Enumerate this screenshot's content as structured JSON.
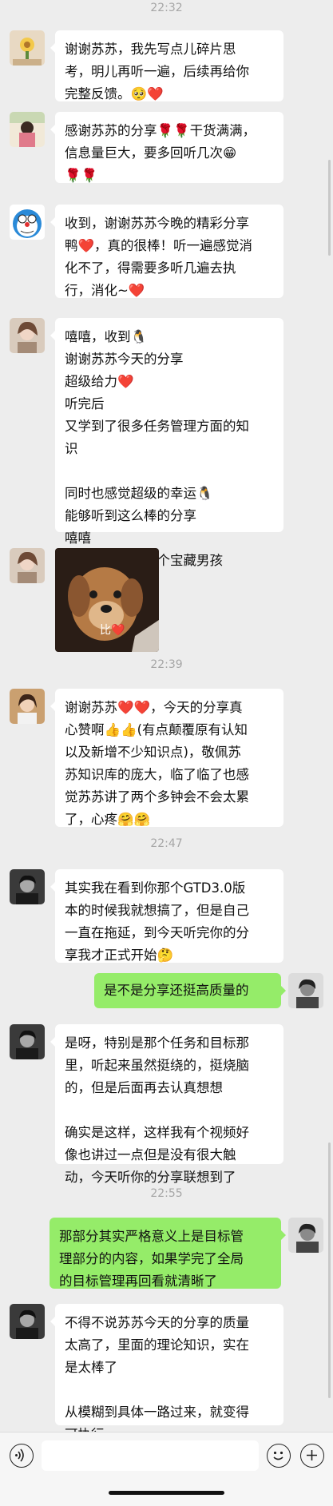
{
  "timestamps": [
    "22:32",
    "22:39",
    "22:47",
    "22:55"
  ],
  "messages": [
    {
      "text": "谢谢苏苏，我先写点儿碎片思\n考，明儿再听一遍，后续再给你\n完整反馈。🥺❤️"
    },
    {
      "text": "感谢苏苏的分享🌹🌹干货满满，\n信息量巨大，要多回听几次😁\n🌹🌹"
    },
    {
      "text": "收到，谢谢苏苏今晚的精彩分享\n鸭❤️，真的很棒！听一遍感觉消\n化不了，得需要多听几遍去执\n行，消化~❤️"
    },
    {
      "text": "嘻嘻，收到🐧\n谢谢苏苏今天的分享\n超级给力❤️\n听完后\n又学到了很多任务管理方面的知\n识\n\n同时也感觉超级的幸运🐧\n能够听到这么棒的分享\n嘻嘻\n苏苏永远都是一个宝藏男孩"
    },
    {
      "sticker_text": "比❤️"
    },
    {
      "text": "谢谢苏苏❤️❤️，今天的分享真\n心赞啊👍👍(有点颠覆原有认知\n以及新增不少知识点)，敬佩苏\n苏知识库的庞大，临了临了也感\n觉苏苏讲了两个多钟会不会太累\n了，心疼🤗🤗"
    },
    {
      "text": "其实我在看到你那个GTD3.0版\n本的时候我就想搞了，但是自己\n一直在拖延，到今天听完你的分\n享我才正式开始🤔"
    },
    {
      "text": "是不是分享还挺高质量的"
    },
    {
      "text": "是呀，特别是那个任务和目标那\n里，听起来虽然挺绕的，挺烧脑\n的，但是后面再去认真想想\n\n确实是这样，这样我有个视频好\n像也讲过一点但是没有很大触\n动，今天听你的分享联想到了"
    },
    {
      "text": "那部分其实严格意义上是目标管\n理部分的内容，如果学完了全局\n的目标管理再回看就清晰了"
    },
    {
      "text": "不得不说苏苏今天的分享的质量\n太高了，里面的理论知识，实在\n是太棒了\n\n从模糊到具体一路过来，就变得\n可执行"
    }
  ],
  "input": {
    "value": "",
    "placeholder": ""
  },
  "icons": {
    "voice": "voice-icon",
    "emoji": "emoji-icon",
    "more": "plus-icon"
  }
}
